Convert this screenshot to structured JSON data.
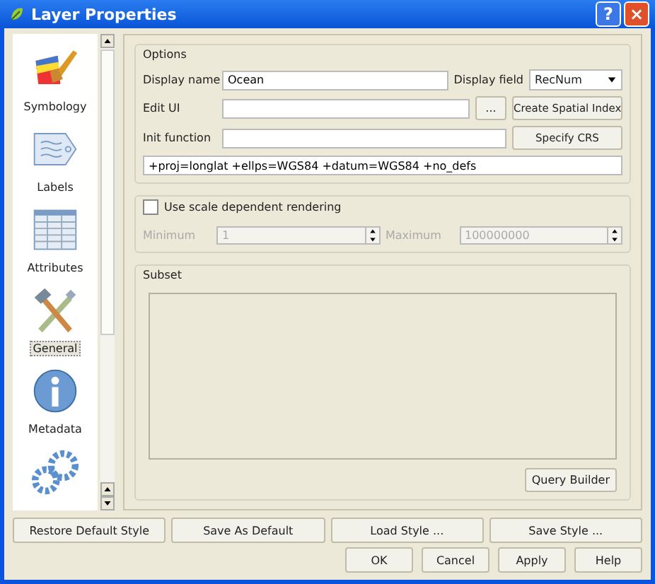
{
  "window": {
    "title": "Layer Properties",
    "help_button": "?",
    "close_button": "×"
  },
  "sidebar": {
    "items": [
      {
        "label": "Symbology",
        "kind": "brush",
        "selected": false
      },
      {
        "label": "Labels",
        "kind": "tag",
        "selected": false
      },
      {
        "label": "Attributes",
        "kind": "table",
        "selected": false
      },
      {
        "label": "General",
        "kind": "tools",
        "selected": true
      },
      {
        "label": "Metadata",
        "kind": "info",
        "selected": false
      },
      {
        "kind": "gears",
        "selected": false
      }
    ]
  },
  "options": {
    "title": "Options",
    "display_name_label": "Display name",
    "display_name": "Ocean",
    "display_field_label": "Display field",
    "display_field": "RecNum",
    "edit_ui_label": "Edit UI",
    "browse_button": "...",
    "spatial_index_button": "Create Spatial Index",
    "init_function_label": "Init function",
    "crs_button": "Specify CRS",
    "crs": "+proj=longlat +ellps=WGS84 +datum=WGS84 +no_defs"
  },
  "scale": {
    "label": "Use scale dependent rendering",
    "checked": false,
    "minimum_label": "Minimum",
    "minimum": "1",
    "maximum_label": "Maximum",
    "maximum": "100000000"
  },
  "subset": {
    "title": "Subset",
    "query_button": "Query Builder"
  },
  "style_buttons": [
    "Restore Default Style",
    "Save As Default",
    "Load Style ...",
    "Save Style ..."
  ],
  "dialog_buttons": [
    "OK",
    "Cancel",
    "Apply",
    "Help"
  ]
}
